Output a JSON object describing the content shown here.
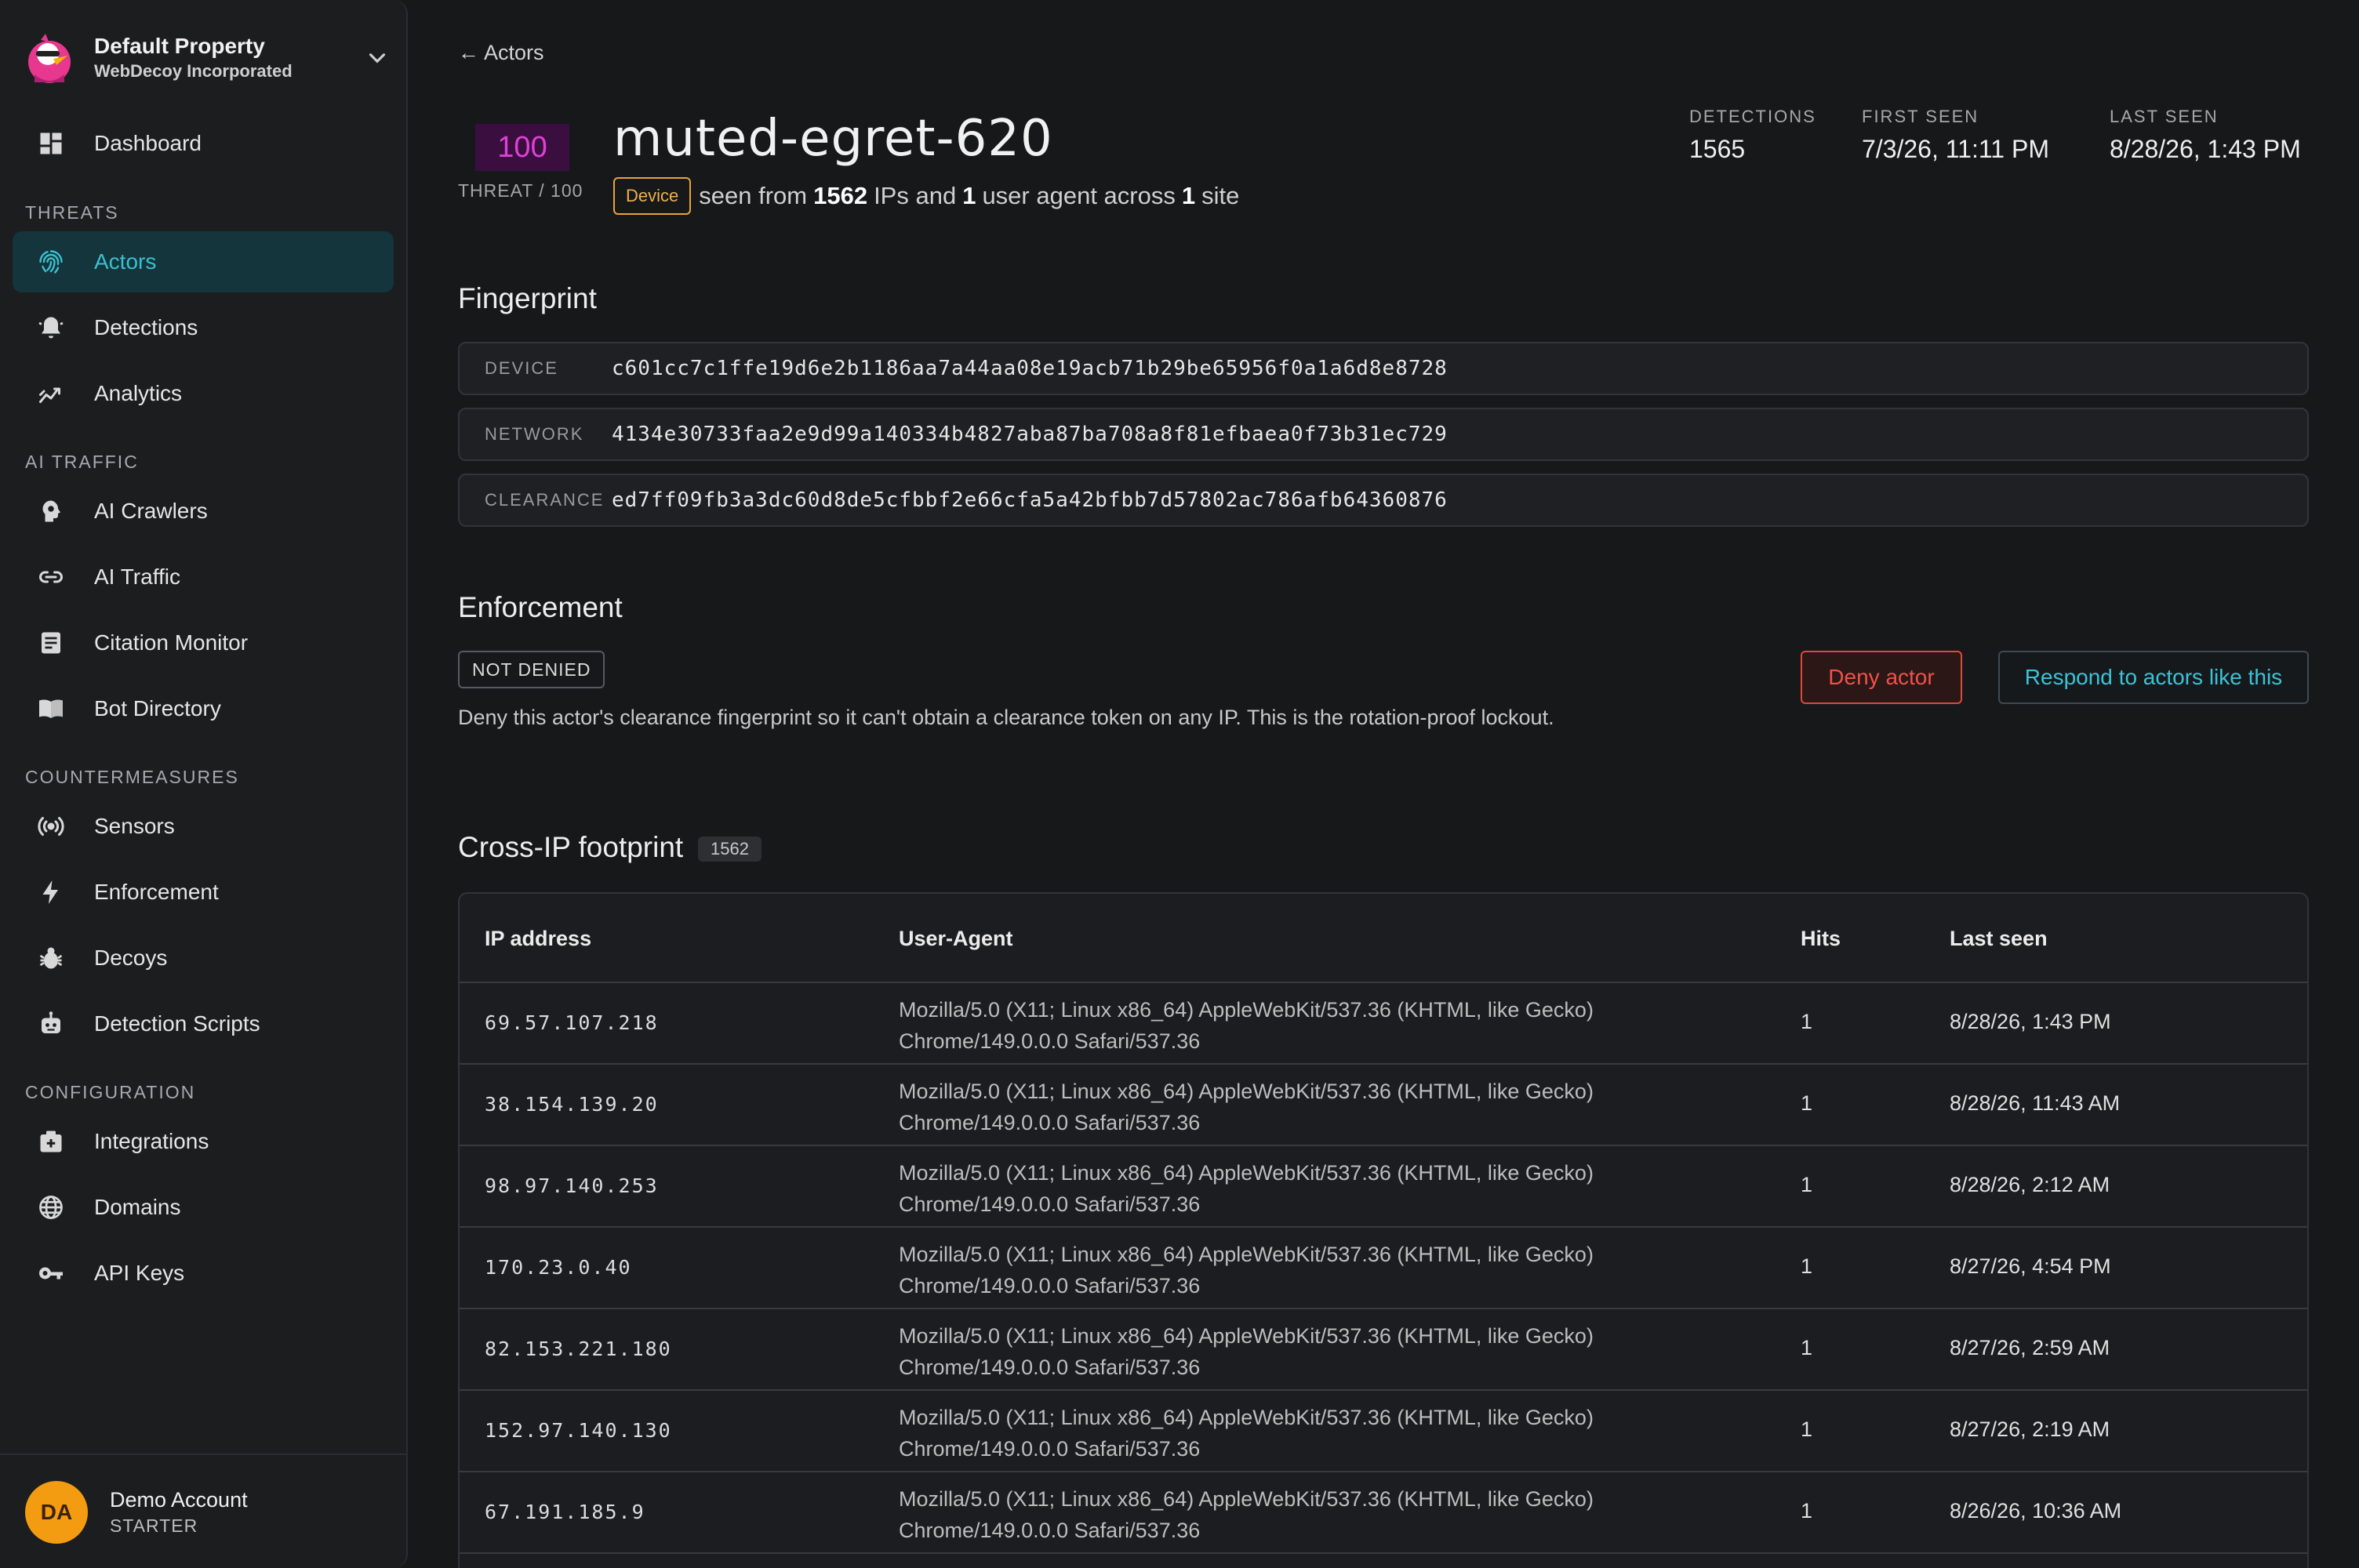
{
  "property": {
    "name": "Default Property",
    "org": "WebDecoy Incorporated"
  },
  "nav": {
    "dashboard": "Dashboard",
    "sections": {
      "threats": "THREATS",
      "ai_traffic": "AI TRAFFIC",
      "countermeasures": "COUNTERMEASURES",
      "configuration": "CONFIGURATION"
    },
    "items": {
      "actors": "Actors",
      "detections": "Detections",
      "analytics": "Analytics",
      "ai_crawlers": "AI Crawlers",
      "ai_traffic": "AI Traffic",
      "citation_monitor": "Citation Monitor",
      "bot_directory": "Bot Directory",
      "sensors": "Sensors",
      "enforcement": "Enforcement",
      "decoys": "Decoys",
      "detection_scripts": "Detection Scripts",
      "integrations": "Integrations",
      "domains": "Domains",
      "api_keys": "API Keys"
    },
    "active": "actors"
  },
  "account": {
    "initials": "DA",
    "name": "Demo Account",
    "plan": "STARTER"
  },
  "header": {
    "back_label": "← Actors",
    "threat_score": "100",
    "threat_label": "THREAT / 100",
    "actor_name": "muted-egret-620",
    "badge": "Device",
    "seen_from_prefix": "seen from",
    "ip_count": "1562",
    "ips_text": "IPs and",
    "ua_count": "1",
    "ua_text": "user agent across",
    "site_count": "1",
    "site_text": "site",
    "stats": {
      "detections_label": "DETECTIONS",
      "detections": "1565",
      "first_seen_label": "FIRST SEEN",
      "first_seen": "7/3/26, 11:11 PM",
      "last_seen_label": "LAST SEEN",
      "last_seen": "8/28/26, 1:43 PM"
    }
  },
  "fingerprint": {
    "title": "Fingerprint",
    "rows": [
      {
        "key": "DEVICE",
        "value": "c601cc7c1ffe19d6e2b1186aa7a44aa08e19acb71b29be65956f0a1a6d8e8728"
      },
      {
        "key": "NETWORK",
        "value": "4134e30733faa2e9d99a140334b4827aba87ba708a8f81efbaea0f73b31ec729"
      },
      {
        "key": "CLEARANCE",
        "value": "ed7ff09fb3a3dc60d8de5cfbbf2e66cfa5a42bfbb7d57802ac786afb64360876"
      }
    ]
  },
  "enforcement": {
    "title": "Enforcement",
    "status": "NOT DENIED",
    "description": "Deny this actor's clearance fingerprint so it can't obtain a clearance token on any IP. This is the rotation-proof lockout.",
    "deny_label": "Deny actor",
    "respond_label": "Respond to actors like this"
  },
  "footprint": {
    "title": "Cross-IP footprint",
    "count": "1562",
    "columns": {
      "ip": "IP address",
      "ua": "User-Agent",
      "hits": "Hits",
      "last_seen": "Last seen"
    },
    "rows": [
      {
        "ip": "69.57.107.218",
        "ua": "Mozilla/5.0 (X11; Linux x86_64) AppleWebKit/537.36 (KHTML, like Gecko) Chrome/149.0.0.0 Safari/537.36",
        "hits": "1",
        "last_seen": "8/28/26, 1:43 PM"
      },
      {
        "ip": "38.154.139.20",
        "ua": "Mozilla/5.0 (X11; Linux x86_64) AppleWebKit/537.36 (KHTML, like Gecko) Chrome/149.0.0.0 Safari/537.36",
        "hits": "1",
        "last_seen": "8/28/26, 11:43 AM"
      },
      {
        "ip": "98.97.140.253",
        "ua": "Mozilla/5.0 (X11; Linux x86_64) AppleWebKit/537.36 (KHTML, like Gecko) Chrome/149.0.0.0 Safari/537.36",
        "hits": "1",
        "last_seen": "8/28/26, 2:12 AM"
      },
      {
        "ip": "170.23.0.40",
        "ua": "Mozilla/5.0 (X11; Linux x86_64) AppleWebKit/537.36 (KHTML, like Gecko) Chrome/149.0.0.0 Safari/537.36",
        "hits": "1",
        "last_seen": "8/27/26, 4:54 PM"
      },
      {
        "ip": "82.153.221.180",
        "ua": "Mozilla/5.0 (X11; Linux x86_64) AppleWebKit/537.36 (KHTML, like Gecko) Chrome/149.0.0.0 Safari/537.36",
        "hits": "1",
        "last_seen": "8/27/26, 2:59 AM"
      },
      {
        "ip": "152.97.140.130",
        "ua": "Mozilla/5.0 (X11; Linux x86_64) AppleWebKit/537.36 (KHTML, like Gecko) Chrome/149.0.0.0 Safari/537.36",
        "hits": "1",
        "last_seen": "8/27/26, 2:19 AM"
      },
      {
        "ip": "67.191.185.9",
        "ua": "Mozilla/5.0 (X11; Linux x86_64) AppleWebKit/537.36 (KHTML, like Gecko) Chrome/149.0.0.0 Safari/537.36",
        "hits": "1",
        "last_seen": "8/26/26, 10:36 AM"
      }
    ]
  },
  "colors": {
    "accent": "#3bbfd0",
    "threat": "#e040d8",
    "danger": "#f0524a",
    "device_badge": "#f0b14a",
    "avatar": "#f39c12"
  }
}
